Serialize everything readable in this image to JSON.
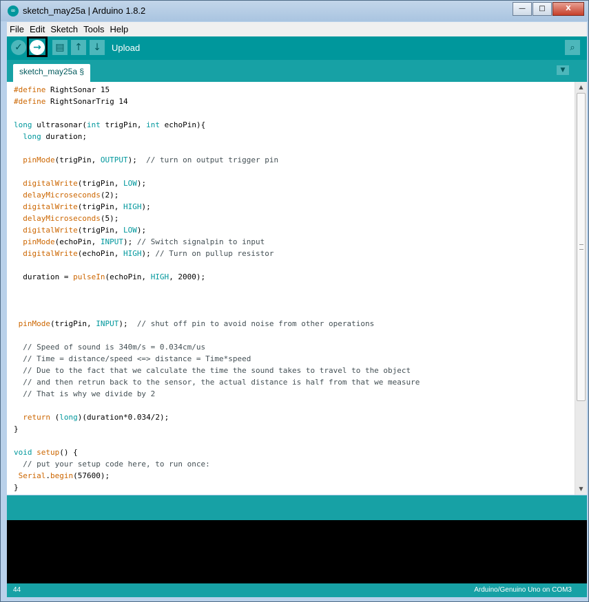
{
  "window": {
    "title": "sketch_may25a | Arduino 1.8.2"
  },
  "window_buttons": {
    "minimize": "—",
    "maximize": "□",
    "close": "X"
  },
  "menu": [
    "File",
    "Edit",
    "Sketch",
    "Tools",
    "Help"
  ],
  "toolbar": {
    "verify_icon": "✓",
    "upload_icon": "→",
    "new_icon": "▤",
    "open_icon": "↑",
    "save_icon": "↓",
    "label": "Upload",
    "serial_monitor_icon": "⌕"
  },
  "tab": {
    "label": "sketch_may25a §",
    "menu_icon": "▼"
  },
  "colors": {
    "teal": "#00979c",
    "keyword": "#cc6600",
    "type": "#00979c",
    "comment": "#434f54"
  },
  "code": [
    [
      [
        "#define",
        "k"
      ],
      [
        " RightSonar 15",
        ""
      ]
    ],
    [
      [
        "#define",
        "k"
      ],
      [
        " RightSonarTrig 14",
        ""
      ]
    ],
    [],
    [
      [
        "long",
        "t"
      ],
      [
        " ultrasonar(",
        ""
      ],
      [
        "int",
        "t"
      ],
      [
        " trigPin, ",
        ""
      ],
      [
        "int",
        "t"
      ],
      [
        " echoPin){",
        ""
      ]
    ],
    [
      [
        "  ",
        ""
      ],
      [
        "long",
        "t"
      ],
      [
        " duration;",
        ""
      ]
    ],
    [],
    [
      [
        "  ",
        ""
      ],
      [
        "pinMode",
        "f"
      ],
      [
        "(trigPin, ",
        ""
      ],
      [
        "OUTPUT",
        "c"
      ],
      [
        ");  ",
        ""
      ],
      [
        "// turn on output trigger pin",
        "m"
      ]
    ],
    [],
    [
      [
        "  ",
        ""
      ],
      [
        "digitalWrite",
        "f"
      ],
      [
        "(trigPin, ",
        ""
      ],
      [
        "LOW",
        "c"
      ],
      [
        ");",
        ""
      ]
    ],
    [
      [
        "  ",
        ""
      ],
      [
        "delayMicroseconds",
        "f"
      ],
      [
        "(2);",
        ""
      ]
    ],
    [
      [
        "  ",
        ""
      ],
      [
        "digitalWrite",
        "f"
      ],
      [
        "(trigPin, ",
        ""
      ],
      [
        "HIGH",
        "c"
      ],
      [
        ");",
        ""
      ]
    ],
    [
      [
        "  ",
        ""
      ],
      [
        "delayMicroseconds",
        "f"
      ],
      [
        "(5);",
        ""
      ]
    ],
    [
      [
        "  ",
        ""
      ],
      [
        "digitalWrite",
        "f"
      ],
      [
        "(trigPin, ",
        ""
      ],
      [
        "LOW",
        "c"
      ],
      [
        ");",
        ""
      ]
    ],
    [
      [
        "  ",
        ""
      ],
      [
        "pinMode",
        "f"
      ],
      [
        "(echoPin, ",
        ""
      ],
      [
        "INPUT",
        "c"
      ],
      [
        "); ",
        ""
      ],
      [
        "// Switch signalpin to input",
        "m"
      ]
    ],
    [
      [
        "  ",
        ""
      ],
      [
        "digitalWrite",
        "f"
      ],
      [
        "(echoPin, ",
        ""
      ],
      [
        "HIGH",
        "c"
      ],
      [
        "); ",
        ""
      ],
      [
        "// Turn on pullup resistor",
        "m"
      ]
    ],
    [],
    [
      [
        "  duration = ",
        ""
      ],
      [
        "pulseIn",
        "f"
      ],
      [
        "(echoPin, ",
        ""
      ],
      [
        "HIGH",
        "c"
      ],
      [
        ", 2000);",
        ""
      ]
    ],
    [],
    [],
    [],
    [
      [
        " ",
        ""
      ],
      [
        "pinMode",
        "f"
      ],
      [
        "(trigPin, ",
        ""
      ],
      [
        "INPUT",
        "c"
      ],
      [
        ");  ",
        ""
      ],
      [
        "// shut off pin to avoid noise from other operations",
        "m"
      ]
    ],
    [],
    [
      [
        "  ",
        ""
      ],
      [
        "// Speed of sound is 340m/s = 0.034cm/us",
        "m"
      ]
    ],
    [
      [
        "  ",
        ""
      ],
      [
        "// Time = distance/speed <=> distance = Time*speed",
        "m"
      ]
    ],
    [
      [
        "  ",
        ""
      ],
      [
        "// Due to the fact that we calculate the time the sound takes to travel to the object",
        "m"
      ]
    ],
    [
      [
        "  ",
        ""
      ],
      [
        "// and then retrun back to the sensor, the actual distance is half from that we measure",
        "m"
      ]
    ],
    [
      [
        "  ",
        ""
      ],
      [
        "// That is why we divide by 2",
        "m"
      ]
    ],
    [],
    [
      [
        "  ",
        ""
      ],
      [
        "return",
        "k"
      ],
      [
        " (",
        ""
      ],
      [
        "long",
        "t"
      ],
      [
        ")(duration*0.034/2);",
        ""
      ]
    ],
    [
      [
        "}",
        ""
      ]
    ],
    [],
    [
      [
        "void",
        "t"
      ],
      [
        " ",
        ""
      ],
      [
        "setup",
        "f"
      ],
      [
        "() {",
        ""
      ]
    ],
    [
      [
        "  ",
        ""
      ],
      [
        "// put your setup code here, to run once:",
        "m"
      ]
    ],
    [
      [
        " ",
        ""
      ],
      [
        "Serial",
        "f"
      ],
      [
        ".",
        ""
      ],
      [
        "begin",
        "f"
      ],
      [
        "(57600);",
        ""
      ]
    ],
    [
      [
        "}",
        ""
      ]
    ]
  ],
  "scrollbar": {
    "up_icon": "▲",
    "down_icon": "▼",
    "grip_icon": "≡"
  },
  "status": {
    "line": "44",
    "board": "Arduino/Genuino Uno on COM3"
  }
}
